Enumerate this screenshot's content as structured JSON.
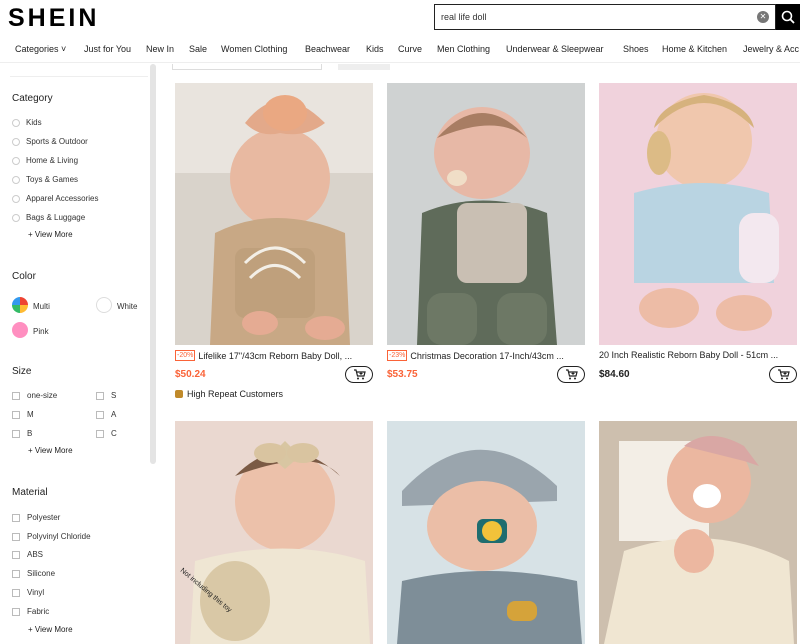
{
  "brand": "SHEIN",
  "search": {
    "value": "real life doll",
    "placeholder": ""
  },
  "nav": [
    "Categories",
    "Just for You",
    "New In",
    "Sale",
    "Women Clothing",
    "Beachwear",
    "Kids",
    "Curve",
    "Men Clothing",
    "Underwear & Sleepwear",
    "Shoes",
    "Home & Kitchen",
    "Jewelry & Acc"
  ],
  "sidebar": {
    "category": {
      "title": "Category",
      "items": [
        "Kids",
        "Sports & Outdoor",
        "Home & Living",
        "Toys & Games",
        "Apparel Accessories",
        "Bags & Luggage"
      ],
      "view_more": "+ View More"
    },
    "color": {
      "title": "Color",
      "items": [
        {
          "label": "Multi",
          "color": "multi"
        },
        {
          "label": "White",
          "color": "#ffffff"
        },
        {
          "label": "Pink",
          "color": "#ff8fc0"
        }
      ]
    },
    "size": {
      "title": "Size",
      "left": [
        "one-size",
        "M",
        "B"
      ],
      "right": [
        "S",
        "A",
        "C"
      ],
      "view_more": "+ View More"
    },
    "material": {
      "title": "Material",
      "items": [
        "Polyester",
        "Polyvinyl Chloride",
        "ABS",
        "Silicone",
        "Vinyl",
        "Fabric"
      ],
      "view_more": "+ View More"
    }
  },
  "products": [
    {
      "discount": "-20%",
      "title": "Lifelike 17\"/43cm Reborn Baby Doll, ...",
      "price": "$50.24",
      "price_color": "#fa6338",
      "badge": "High Repeat Customers"
    },
    {
      "discount": "-23%",
      "title": "Christmas Decoration 17-Inch/43cm ...",
      "price": "$53.75",
      "price_color": "#fa6338",
      "badge": ""
    },
    {
      "discount": "",
      "title": "20 Inch Realistic Reborn Baby Doll - 51cm ...",
      "price": "$84.60",
      "price_color": "#222222",
      "badge": ""
    },
    {
      "discount": "",
      "title": "",
      "price": "",
      "badge": "",
      "image_text": "Not including this toy"
    },
    {
      "discount": "",
      "title": "",
      "price": "",
      "badge": ""
    },
    {
      "discount": "",
      "title": "",
      "price": "",
      "badge": ""
    }
  ],
  "colors": {
    "accent": "#fa6338",
    "brand": "#000000"
  }
}
